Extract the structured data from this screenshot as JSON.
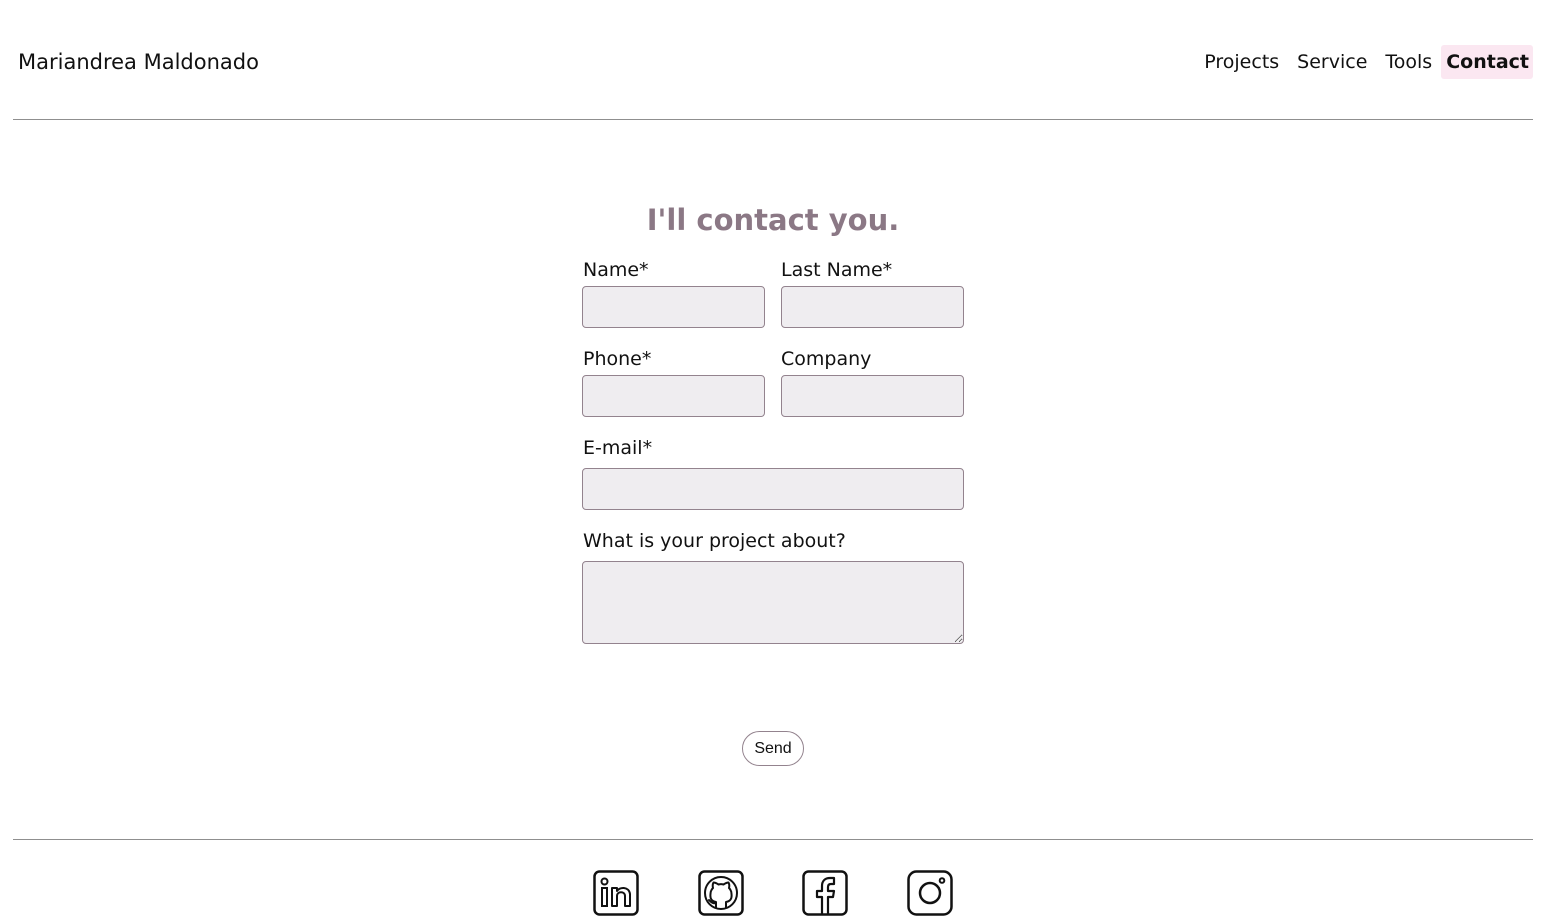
{
  "header": {
    "brand": "Mariandrea Maldonado",
    "nav": [
      {
        "label": "Projects",
        "active": false
      },
      {
        "label": "Service",
        "active": false
      },
      {
        "label": "Tools",
        "active": false
      },
      {
        "label": "Contact",
        "active": true
      }
    ]
  },
  "form": {
    "title": "I'll contact you.",
    "fields": {
      "name": {
        "label": "Name*",
        "value": ""
      },
      "last_name": {
        "label": "Last Name*",
        "value": ""
      },
      "phone": {
        "label": "Phone*",
        "value": ""
      },
      "company": {
        "label": "Company",
        "value": ""
      },
      "email": {
        "label": "E-mail*",
        "value": ""
      },
      "project": {
        "label": "What is your project about?",
        "value": ""
      }
    },
    "send_label": "Send"
  },
  "footer": {
    "social_icons": [
      "linkedin-icon",
      "github-icon",
      "facebook-icon",
      "instagram-icon"
    ]
  },
  "colors": {
    "title": "#8b7885",
    "input_bg": "#efedf0",
    "input_border": "#93838e",
    "active_nav_bg": "#fbe7f1",
    "divider": "#8f8f8f"
  }
}
